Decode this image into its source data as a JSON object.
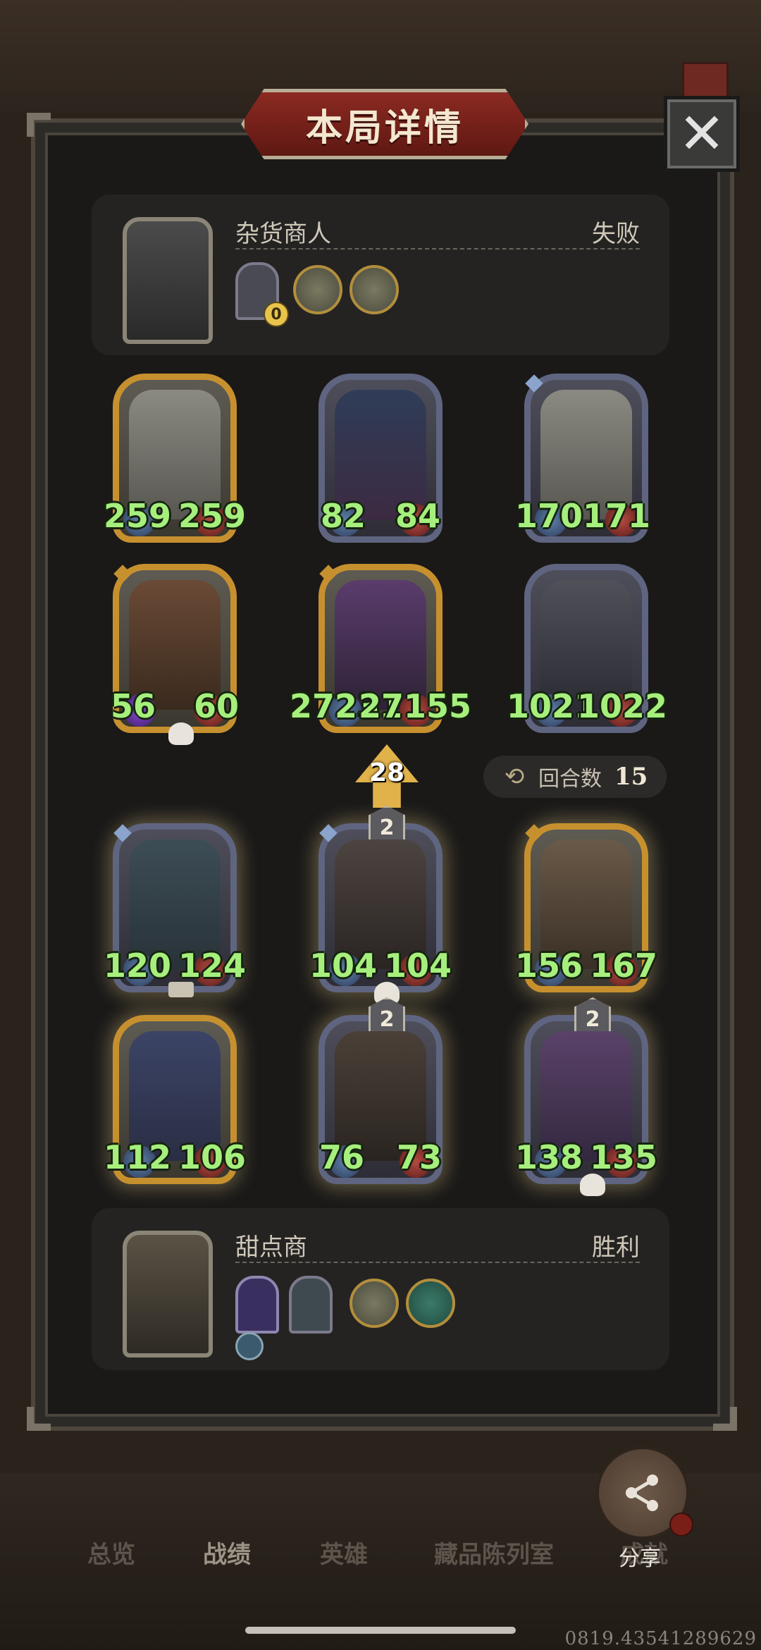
{
  "header": {
    "title": "本局详情"
  },
  "close": {
    "icon": "✕"
  },
  "opponent": {
    "name": "杂货商人",
    "result": "失败",
    "relic_badge": "0"
  },
  "board_enemy": [
    {
      "atk": "259",
      "hp": "259"
    },
    {
      "atk": "82",
      "hp": "84"
    },
    {
      "atk": "170",
      "hp": "171"
    },
    {
      "atk": "56",
      "hp": "60"
    },
    {
      "atk": "27231",
      "hp": "27155"
    },
    {
      "atk": "1021",
      "hp": "1022"
    }
  ],
  "battle": {
    "damage": "28",
    "round_label": "回合数",
    "round_value": "15"
  },
  "board_player": [
    {
      "atk": "120",
      "hp": "124",
      "level": ""
    },
    {
      "atk": "104",
      "hp": "104",
      "level": "2"
    },
    {
      "atk": "156",
      "hp": "167",
      "level": ""
    },
    {
      "atk": "112",
      "hp": "106",
      "level": ""
    },
    {
      "atk": "76",
      "hp": "73",
      "level": "2"
    },
    {
      "atk": "138",
      "hp": "135",
      "level": "2"
    }
  ],
  "player": {
    "name": "甜点商",
    "result": "胜利"
  },
  "nav": {
    "items": [
      "总览",
      "战绩",
      "英雄",
      "藏品陈列室",
      "成就"
    ],
    "active": "战绩",
    "share_label": "分享"
  },
  "version": "0819.43541289629",
  "colors": {
    "stat": "#a6ef7d",
    "gold_frame": "#c7902f",
    "silver_frame": "#5f6580"
  }
}
